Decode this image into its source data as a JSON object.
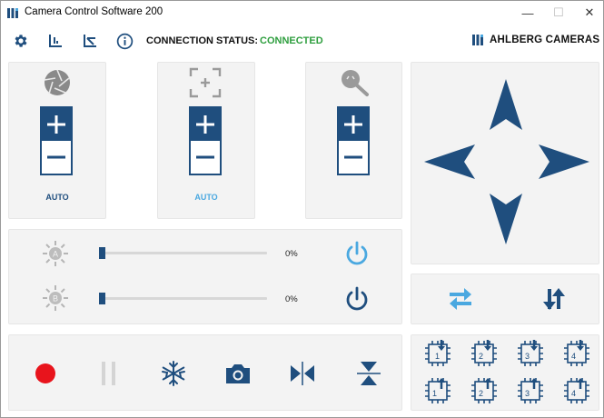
{
  "window": {
    "title": "Camera Control Software 200",
    "controls": [
      "—",
      "☐",
      "✕"
    ]
  },
  "toolbar": {
    "icons": [
      "gear-icon",
      "chart-axes-icon",
      "chart-axes-angled-icon",
      "info-icon"
    ],
    "connection_label": "CONNECTION STATUS:",
    "connection_value": "CONNECTED",
    "connection_color": "#2e9e3e"
  },
  "brand": {
    "name": "AHLBERG CAMERAS"
  },
  "colors": {
    "accent": "#1f4e7e",
    "light_accent": "#4aa8e0",
    "record": "#e8141c"
  },
  "camera_controls": [
    {
      "icon": "aperture-icon",
      "auto_label": "AUTO",
      "auto_active": false
    },
    {
      "icon": "focus-frame-icon",
      "auto_label": "AUTO",
      "auto_active": true
    },
    {
      "icon": "zoom-icon",
      "auto_label": "",
      "auto_active": false
    }
  ],
  "lights": [
    {
      "id": "A",
      "value_text": "0%",
      "value": 0,
      "power_active": true
    },
    {
      "id": "B",
      "value_text": "0%",
      "value": 0,
      "power_active": false
    }
  ],
  "transport": [
    "record-icon",
    "pause-icon",
    "freeze-icon",
    "camera-snapshot-icon",
    "flip-horizontal-icon",
    "flip-vertical-icon"
  ],
  "swap_buttons": [
    "swap-horizontal-icon",
    "swap-vertical-icon"
  ],
  "presets": {
    "row1": [
      "1",
      "2",
      "3",
      "4"
    ],
    "row2": [
      "1",
      "2",
      "3",
      "4"
    ]
  }
}
